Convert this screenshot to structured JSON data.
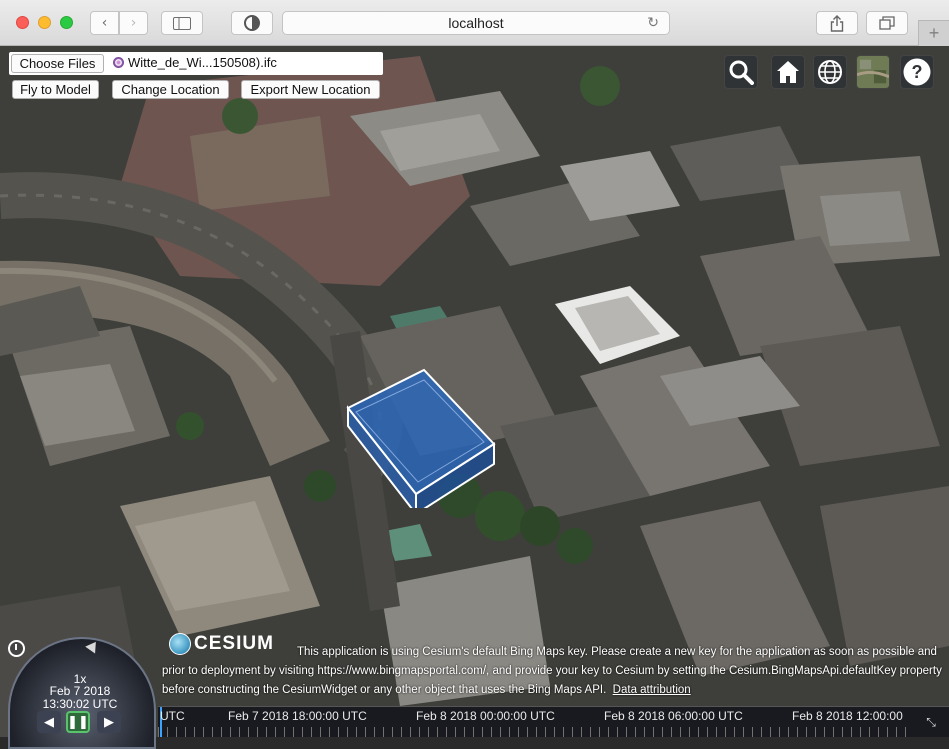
{
  "browser": {
    "url": "localhost",
    "back_icon": "chevron-left-icon",
    "forward_icon": "chevron-right-icon",
    "new_tab_label": "+"
  },
  "toolbar": {
    "choose_files_label": "Choose Files",
    "file_name": "Witte_de_Wi...150508).ifc",
    "fly_to_model_label": "Fly to Model",
    "change_location_label": "Change Location",
    "export_location_label": "Export New Location"
  },
  "cesium_tools": {
    "search_icon": "search-icon",
    "home_icon": "home-icon",
    "globe_icon": "globe-icon",
    "layers_icon": "base-layer-picker-icon",
    "help_label": "?"
  },
  "animation": {
    "speed": "1x",
    "date": "Feb 7 2018",
    "time": "13:30:02 UTC",
    "reverse_label": "◀",
    "pause_label": "❚❚",
    "play_label": "▶"
  },
  "credits": {
    "logo_text": "CESIUM",
    "line1": "This application is using Cesium's default Bing Maps key. Please create a new key for the application as soon as possible and",
    "line2": "prior to deployment by visiting https://www.bingmapsportal.com/, and provide your key to Cesium by setting the Cesium.BingMapsApi.defaultKey property",
    "line3": "before constructing the CesiumWidget or any other object that uses the Bing Maps API.",
    "data_attribution": "Data attribution"
  },
  "timeline": {
    "labels": [
      "UTC",
      "Feb 7 2018 18:00:00 UTC",
      "Feb 8 2018 00:00:00 UTC",
      "Feb 8 2018 06:00:00 UTC",
      "Feb 8 2018 12:00:00"
    ]
  },
  "colors": {
    "model_fill": "#2f6fc0",
    "model_edge": "#ffffff",
    "pause_active": "#59c46c"
  }
}
